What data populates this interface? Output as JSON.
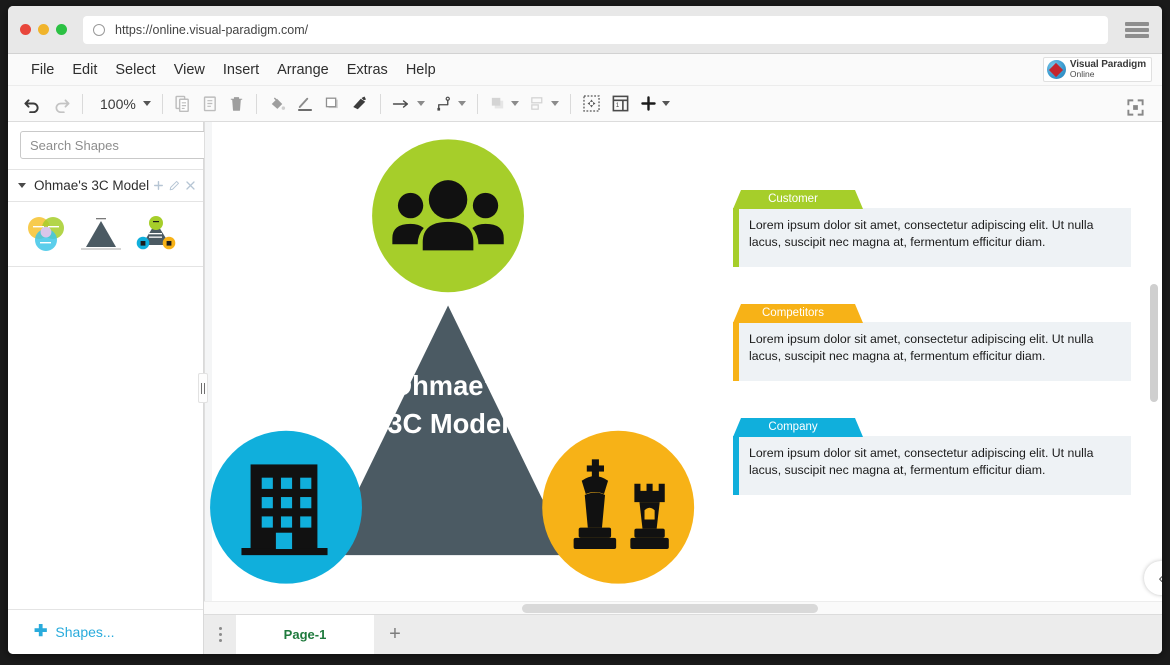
{
  "browser": {
    "url": "https://online.visual-paradigm.com/",
    "reload_icon": "reload-icon",
    "menu_icon": "hamburger-icon"
  },
  "menubar": {
    "items": [
      "File",
      "Edit",
      "Select",
      "View",
      "Insert",
      "Arrange",
      "Extras",
      "Help"
    ],
    "logo": {
      "line1": "Visual Paradigm",
      "line2": "Online"
    }
  },
  "toolbar": {
    "zoom_level": "100%",
    "buttons": [
      "undo-icon",
      "redo-icon",
      "zoom-dropdown",
      "copy-icon",
      "paste-icon",
      "delete-icon",
      "fill-color-icon",
      "line-color-icon",
      "shadow-icon",
      "format-painter-icon",
      "connection-arrow-icon",
      "waypoints-icon",
      "to-front-icon",
      "align-icon",
      "select-all-icon",
      "insert-table-icon",
      "insert-plus-icon",
      "fullscreen-icon"
    ]
  },
  "sidebar": {
    "search": {
      "placeholder": "Search Shapes",
      "value": "",
      "icon": "search-icon"
    },
    "options_icon": "more-options-icon",
    "group": {
      "title": "Ohmae's 3C Model",
      "add_icon": "plus-icon",
      "edit_icon": "pencil-icon",
      "close_icon": "close-icon"
    },
    "thumbnails": [
      "venn-diagram-shape",
      "triangle-shape",
      "3c-model-shape"
    ],
    "footer": {
      "label": "Shapes...",
      "icon": "plus-icon"
    }
  },
  "canvas": {
    "diagram": {
      "title_line1": "Ohmae's",
      "title_line2": "3C Model",
      "triangle_color": "#4b5a63",
      "nodes": [
        {
          "name": "customer",
          "icon": "people-group-icon",
          "color": "#a6ce2a",
          "position": "top"
        },
        {
          "name": "company",
          "icon": "office-building-icon",
          "color": "#10afdc",
          "position": "bottom-left"
        },
        {
          "name": "competitors",
          "icon": "chess-pieces-icon",
          "color": "#f7b217",
          "position": "bottom-right"
        }
      ]
    },
    "cards": [
      {
        "label": "Customer",
        "color": "#a6ce2a",
        "text": "Lorem ipsum dolor sit amet, consectetur adipiscing elit. Ut nulla lacus, suscipit nec magna at, fermentum efficitur diam."
      },
      {
        "label": "Competitors",
        "color": "#f7b217",
        "text": "Lorem ipsum dolor sit amet, consectetur adipiscing elit. Ut nulla lacus, suscipit nec magna at, fermentum efficitur diam."
      },
      {
        "label": "Company",
        "color": "#10afdc",
        "text": "Lorem ipsum dolor sit amet, consectetur adipiscing elit. Ut nulla lacus, suscipit nec magna at, fermentum efficitur diam."
      }
    ]
  },
  "pagebar": {
    "menu_icon": "page-options-icon",
    "tab_label": "Page-1",
    "add_label": "+"
  },
  "collapse_button": {
    "icon": "chevron-left-icon",
    "glyph": "‹"
  }
}
